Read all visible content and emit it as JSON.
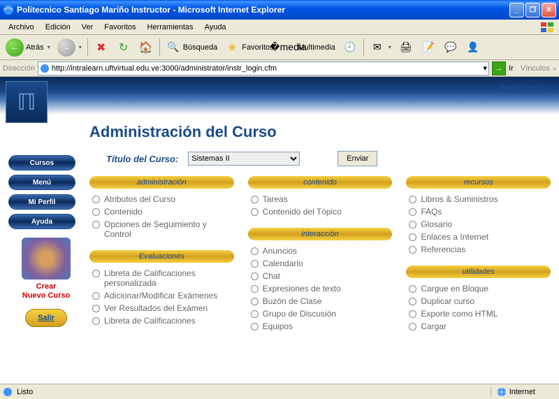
{
  "window": {
    "title": "Politecnico Santiago Mariño Instructor - Microsoft Internet Explorer"
  },
  "menubar": {
    "items": [
      "Archivo",
      "Edición",
      "Ver",
      "Favoritos",
      "Herramientas",
      "Ayuda"
    ]
  },
  "toolbar": {
    "back": "Atrás",
    "search": "Búsqueda",
    "favorites": "Favoritos",
    "multimedia": "Multimedia"
  },
  "addressbar": {
    "label": "Dirección",
    "url": "http://intralearn.uftvirtual.edu.ve:3000/administrator/instr_login.cfm",
    "go": "Ir",
    "links": "Vínculos"
  },
  "banner": {
    "role": "Instructor"
  },
  "sidenav": {
    "items": [
      "Cursos",
      "Menú",
      "Mi Perfil",
      "Ayuda"
    ],
    "create_line1": "Crear",
    "create_line2": "Nuevo Curso",
    "exit": "Salir"
  },
  "page": {
    "title": "Administración del Curso",
    "course_label": "Título del Curso:",
    "course_selected": "Sistemas II",
    "send": "Enviar"
  },
  "sections": {
    "col1": [
      {
        "head": "administración",
        "items": [
          "Atributos del Curso",
          "Contenido",
          "Opciones de Seguimiento y Control"
        ]
      },
      {
        "head": "Evaluaciones",
        "items": [
          "Libreta de Calificaciones personalizada",
          "Adicionar/Modificar Exámenes",
          "Ver Resultados del Exámen",
          "Libreta de Calificaciones"
        ]
      }
    ],
    "col2": [
      {
        "head": "contenido",
        "items": [
          "Tareas",
          "Contenido del Tópico"
        ]
      },
      {
        "head": "interacción",
        "items": [
          "Anuncios",
          "Calendario",
          "Chat",
          "Expresiones de texto",
          "Buzón de Clase",
          "Grupo de Discusión",
          "Equipos"
        ]
      }
    ],
    "col3": [
      {
        "head": "recursos",
        "items": [
          "Libros & Suministros",
          "FAQs",
          "Glosario",
          "Enlaces a Internet",
          "Referencias"
        ]
      },
      {
        "head": "utilidades",
        "items": [
          "Cargue en Bloque",
          "Duplicar curso",
          "Exporte como HTML",
          "Cargar"
        ]
      }
    ]
  },
  "statusbar": {
    "status": "Listo",
    "zone": "Internet"
  }
}
